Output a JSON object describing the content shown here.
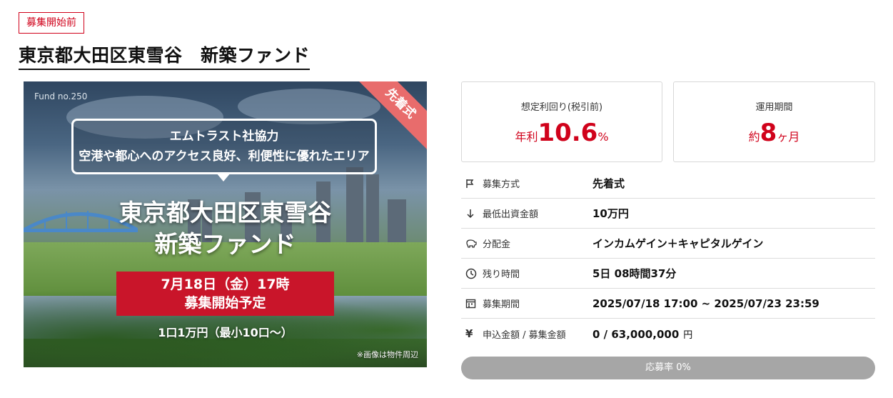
{
  "status_badge": "募集開始前",
  "page_title": "東京都大田区東雪谷　新築ファンド",
  "banner": {
    "fund_no": "Fund no.250",
    "corner_label": "先着式",
    "callout_line1": "エムトラスト社協力",
    "callout_line2": "空港や都心へのアクセス良好、利便性に優れたエリア",
    "title_line1": "東京都大田区東雪谷",
    "title_line2": "新築ファンド",
    "start_line1": "7月18日（金）17時",
    "start_line2": "募集開始予定",
    "unit_text": "1口1万円（最小10口〜）",
    "note": "※画像は物件周辺"
  },
  "stats": {
    "yield_label": "想定利回り(税引前)",
    "yield_prefix": "年利",
    "yield_value": "10.6",
    "yield_suffix": "%",
    "period_label": "運用期間",
    "period_prefix": "約",
    "period_value": "8",
    "period_suffix": "ヶ月"
  },
  "details": [
    {
      "icon": "flag-icon",
      "label": "募集方式",
      "value": "先着式"
    },
    {
      "icon": "arrow-down-icon",
      "label": "最低出資金額",
      "value": "10万円"
    },
    {
      "icon": "piggy-bank-icon",
      "label": "分配金",
      "value": "インカムゲイン＋キャピタルゲイン"
    },
    {
      "icon": "clock-icon",
      "label": "残り時間",
      "value": "5日 08時間37分"
    },
    {
      "icon": "calendar-icon",
      "label": "募集期間",
      "value": "2025/07/18 17:00 ~ 2025/07/23 23:59"
    },
    {
      "icon": "yen-icon",
      "label": "申込金額 / 募集金額",
      "value": "0 / 63,000,000",
      "unit": "円"
    }
  ],
  "progress": {
    "text": "応募率 0%",
    "fraction": 0.0
  },
  "colors": {
    "accent": "#d0021b",
    "progress_track": "#a6a6a6",
    "ribbon": "#e86c6c"
  }
}
